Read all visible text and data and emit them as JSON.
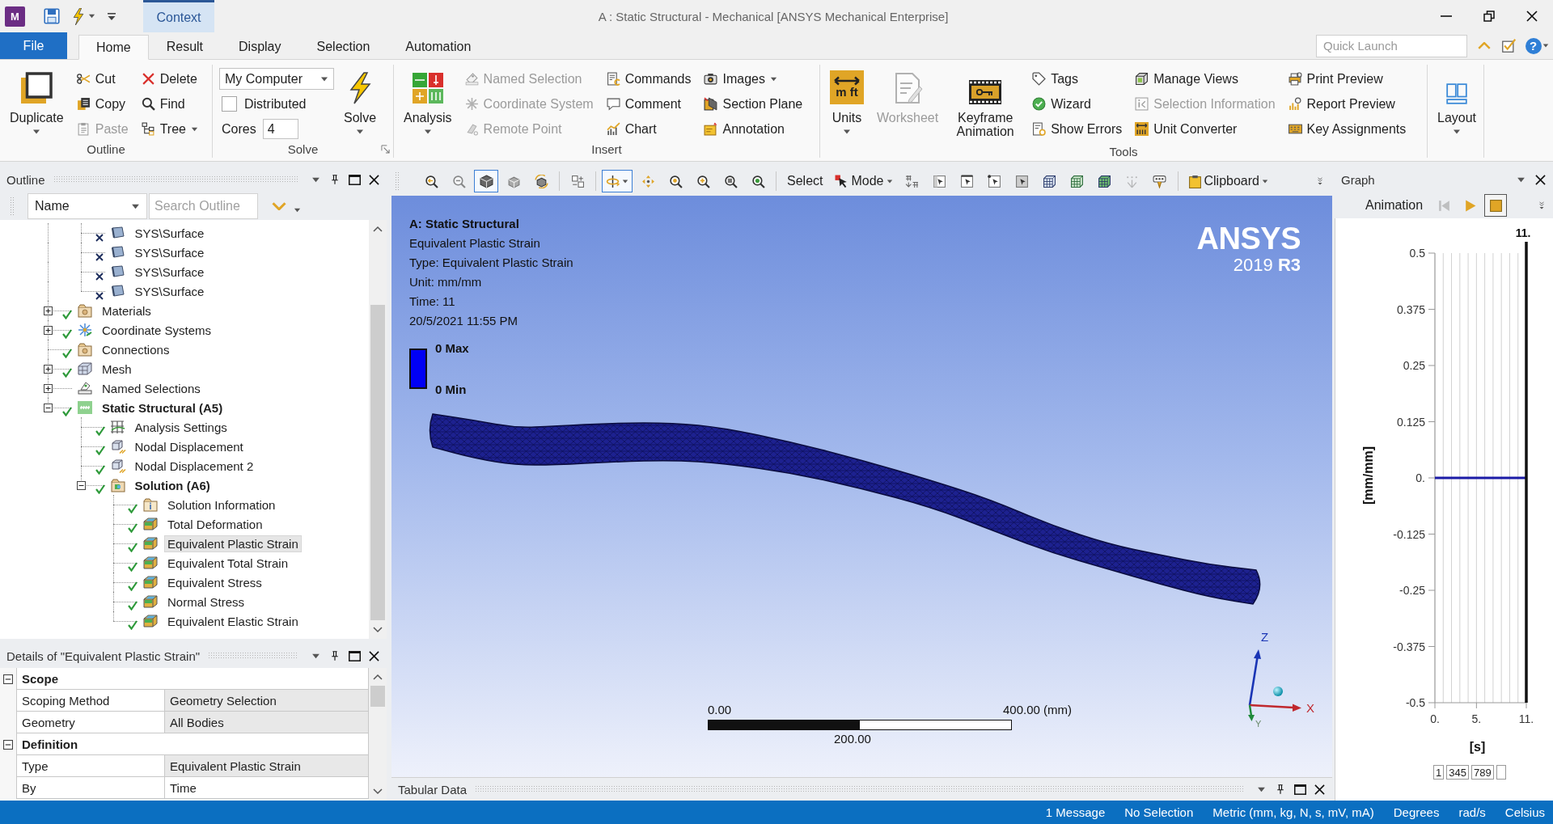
{
  "title_bar": {
    "app_icon": "M",
    "context_tab": "Context",
    "title": "A : Static Structural - Mechanical [ANSYS Mechanical Enterprise]"
  },
  "menu_tabs": [
    {
      "label": "File",
      "kind": "file",
      "selected": false
    },
    {
      "label": "Home",
      "kind": "tab",
      "selected": true
    },
    {
      "label": "Result",
      "kind": "tab",
      "selected": false
    },
    {
      "label": "Display",
      "kind": "tab",
      "selected": false
    },
    {
      "label": "Selection",
      "kind": "tab",
      "selected": false
    },
    {
      "label": "Automation",
      "kind": "tab",
      "selected": false
    }
  ],
  "quick_launch": {
    "placeholder": "Quick Launch",
    "help": "?"
  },
  "ribbon_groups": [
    {
      "label": "Outline",
      "columns": [
        {
          "kind": "large",
          "label": "Duplicate",
          "menu": true,
          "disabled": false
        },
        {
          "kind": "stack",
          "items": [
            {
              "kind": "button",
              "label": "Cut",
              "disabled": false
            },
            {
              "kind": "button",
              "label": "Copy",
              "disabled": false
            },
            {
              "kind": "button",
              "label": "Paste",
              "disabled": true
            }
          ]
        },
        {
          "kind": "stack",
          "items": [
            {
              "kind": "button",
              "label": "Delete",
              "disabled": false
            },
            {
              "kind": "button",
              "label": "Find",
              "disabled": false
            },
            {
              "kind": "button",
              "label": "Tree",
              "menu": true,
              "disabled": false
            }
          ]
        }
      ]
    },
    {
      "label": "Solve",
      "launcher": true,
      "columns": [
        {
          "kind": "stack",
          "items": [
            {
              "kind": "dropdown",
              "value": "My Computer"
            },
            {
              "kind": "checkbox",
              "label": "Distributed",
              "checked": false
            },
            {
              "kind": "spin",
              "label": "Cores",
              "value": "4"
            }
          ]
        },
        {
          "kind": "large",
          "label": "Solve",
          "menu": true,
          "disabled": false
        }
      ]
    },
    {
      "label": "Insert",
      "columns": [
        {
          "kind": "large",
          "label": "Analysis",
          "menu": true,
          "disabled": false
        },
        {
          "kind": "stack",
          "items": [
            {
              "kind": "button",
              "label": "Named Selection",
              "disabled": true
            },
            {
              "kind": "button",
              "label": "Coordinate System",
              "disabled": true
            },
            {
              "kind": "button",
              "label": "Remote Point",
              "disabled": true
            }
          ]
        },
        {
          "kind": "stack",
          "items": [
            {
              "kind": "button",
              "label": "Commands",
              "disabled": false
            },
            {
              "kind": "button",
              "label": "Comment",
              "disabled": false
            },
            {
              "kind": "button",
              "label": "Chart",
              "disabled": false
            }
          ]
        },
        {
          "kind": "stack",
          "items": [
            {
              "kind": "button",
              "label": "Images",
              "menu": true,
              "disabled": false
            },
            {
              "kind": "button",
              "label": "Section Plane",
              "disabled": false
            },
            {
              "kind": "button",
              "label": "Annotation",
              "disabled": false
            }
          ]
        }
      ]
    },
    {
      "label": "Tools",
      "columns": [
        {
          "kind": "large",
          "label": "Units",
          "icon_text": "m ft",
          "menu": true,
          "disabled": false
        },
        {
          "kind": "large",
          "label": "Worksheet",
          "disabled": true
        },
        {
          "kind": "large",
          "label": "Keyframe Animation",
          "disabled": false
        },
        {
          "kind": "stack",
          "items": [
            {
              "kind": "button",
              "label": "Tags",
              "disabled": false
            },
            {
              "kind": "button",
              "label": "Wizard",
              "disabled": false
            },
            {
              "kind": "button",
              "label": "Show Errors",
              "disabled": false
            }
          ]
        },
        {
          "kind": "stack",
          "items": [
            {
              "kind": "button",
              "label": "Manage Views",
              "disabled": false
            },
            {
              "kind": "button",
              "label": "Selection Information",
              "disabled": true
            },
            {
              "kind": "button",
              "label": "Unit Converter",
              "disabled": false
            }
          ]
        },
        {
          "kind": "stack",
          "items": [
            {
              "kind": "button",
              "label": "Print Preview",
              "disabled": false
            },
            {
              "kind": "button",
              "label": "Report Preview",
              "disabled": false
            },
            {
              "kind": "button",
              "label": "Key Assignments",
              "disabled": false
            }
          ]
        }
      ]
    },
    {
      "columns": [
        {
          "kind": "large",
          "label": "Layout",
          "menu": true,
          "disabled": false
        }
      ]
    }
  ],
  "outline": {
    "title": "Outline",
    "filter": "Name",
    "search": {
      "placeholder": "Search Outline"
    },
    "tree": [
      {
        "children": [
          {
            "label": "SYS\\Surface",
            "kind": "body",
            "checked": false,
            "crossed": true,
            "selected": false
          },
          {
            "label": "SYS\\Surface",
            "kind": "body",
            "checked": false,
            "crossed": true,
            "selected": false
          },
          {
            "label": "SYS\\Surface",
            "kind": "body",
            "checked": false,
            "crossed": true,
            "selected": false
          },
          {
            "label": "SYS\\Surface",
            "kind": "body",
            "checked": false,
            "crossed": true,
            "selected": false
          }
        ]
      },
      {
        "label": "Materials",
        "kind": "materials",
        "checked": true,
        "crossed": false,
        "expanded": false,
        "selected": false
      },
      {
        "label": "Coordinate Systems",
        "kind": "coordinates",
        "checked": true,
        "crossed": false,
        "expanded": false,
        "selected": false
      },
      {
        "label": "Connections",
        "kind": "connections",
        "checked": true,
        "crossed": false,
        "selected": false
      },
      {
        "label": "Mesh",
        "kind": "mesh",
        "checked": true,
        "crossed": false,
        "expanded": false,
        "selected": false
      },
      {
        "label": "Named Selections",
        "kind": "named",
        "checked": false,
        "crossed": false,
        "expanded": false,
        "selected": false
      },
      {
        "label": "Static Structural (A5)",
        "kind": "analysis",
        "checked": true,
        "crossed": false,
        "expanded": true,
        "selected": false,
        "children": [
          {
            "label": "Analysis Settings",
            "kind": "settings",
            "checked": true,
            "crossed": false,
            "selected": false
          },
          {
            "label": "Nodal Displacement",
            "kind": "displacement",
            "checked": true,
            "crossed": false,
            "selected": false
          },
          {
            "label": "Nodal Displacement 2",
            "kind": "displacement",
            "checked": true,
            "crossed": false,
            "selected": false
          },
          {
            "label": "Solution (A6)",
            "kind": "solution",
            "checked": true,
            "crossed": false,
            "expanded": true,
            "selected": false,
            "children": [
              {
                "label": "Solution Information",
                "kind": "info",
                "checked": true,
                "crossed": false,
                "selected": false
              },
              {
                "label": "Total Deformation",
                "kind": "result",
                "checked": true,
                "crossed": false,
                "selected": false
              },
              {
                "label": "Equivalent Plastic Strain",
                "kind": "result",
                "checked": true,
                "crossed": false,
                "selected": true
              },
              {
                "label": "Equivalent Total Strain",
                "kind": "result",
                "checked": true,
                "crossed": false,
                "selected": false
              },
              {
                "label": "Equivalent Stress",
                "kind": "result",
                "checked": true,
                "crossed": false,
                "selected": false
              },
              {
                "label": "Normal Stress",
                "kind": "result",
                "checked": true,
                "crossed": false,
                "selected": false
              },
              {
                "label": "Equivalent Elastic Strain",
                "kind": "result",
                "checked": true,
                "crossed": false,
                "selected": false
              }
            ]
          }
        ]
      }
    ]
  },
  "details": {
    "title": "Details of \"Equivalent Plastic Strain\"",
    "groups": [
      {
        "label": "Scope",
        "expanded": true,
        "rows": [
          {
            "name": "Scoping Method",
            "value": "Geometry Selection",
            "readonly": true
          },
          {
            "name": "Geometry",
            "value": "All Bodies",
            "readonly": true
          }
        ]
      },
      {
        "label": "Definition",
        "expanded": true,
        "rows": [
          {
            "name": "Type",
            "value": "Equivalent Plastic Strain",
            "readonly": true
          },
          {
            "name": "By",
            "value": "Time",
            "readonly": false
          }
        ]
      }
    ]
  },
  "viewport_toolbar": {
    "groups": [
      {
        "tools": [
          {
            "kind": "zoomfit",
            "selected": false,
            "disabled": false
          },
          {
            "kind": "zoomout",
            "selected": false,
            "disabled": true
          },
          {
            "kind": "iso",
            "selected": true,
            "disabled": false
          },
          {
            "kind": "shaded",
            "selected": false,
            "disabled": false
          },
          {
            "kind": "rotview",
            "selected": false,
            "disabled": false
          }
        ]
      },
      {
        "tools": [
          {
            "kind": "tiles",
            "selected": false,
            "disabled": false
          }
        ]
      },
      {
        "tools": [
          {
            "kind": "rotate",
            "selected": true,
            "menu": true,
            "disabled": false
          },
          {
            "kind": "pan",
            "selected": false,
            "disabled": false
          },
          {
            "kind": "zoom",
            "selected": false,
            "disabled": false
          },
          {
            "kind": "zoomin",
            "selected": false,
            "disabled": false
          },
          {
            "kind": "boxzoom",
            "selected": false,
            "disabled": false
          },
          {
            "kind": "magnify",
            "selected": false,
            "disabled": false
          }
        ]
      },
      {
        "label": "Select",
        "tools": [
          {
            "kind": "mode",
            "label": "Mode",
            "selected": false,
            "menu": true,
            "disabled": false
          },
          {
            "kind": "extend",
            "selected": false,
            "disabled": false
          },
          {
            "kind": "facesel",
            "selected": false,
            "disabled": false
          },
          {
            "kind": "edgesel",
            "selected": false,
            "disabled": false
          },
          {
            "kind": "vertexsel",
            "selected": false,
            "disabled": false
          },
          {
            "kind": "bodysel",
            "selected": false,
            "disabled": false
          },
          {
            "kind": "nodesel",
            "selected": false,
            "disabled": false
          },
          {
            "kind": "elemfacesel",
            "selected": false,
            "disabled": false
          },
          {
            "kind": "elemsel",
            "selected": false,
            "disabled": false
          },
          {
            "kind": "coordsel",
            "selected": false,
            "disabled": true
          },
          {
            "kind": "probe",
            "selected": false,
            "disabled": false
          }
        ]
      },
      {
        "tools": [
          {
            "kind": "clipboard",
            "label": "Clipboard",
            "selected": false,
            "menu": true,
            "disabled": false
          }
        ]
      }
    ]
  },
  "viewport": {
    "info_title": "A: Static Structural",
    "info_lines": [
      "Equivalent Plastic Strain",
      "Type: Equivalent Plastic Strain",
      "Unit: mm/mm",
      "Time: 11",
      "20/5/2021 11:55 PM"
    ],
    "logo": "ANSYS",
    "version": "2019 **R3**",
    "legend": [
      "0 Max",
      "0 Min"
    ],
    "scale_bar": {
      "start": "0.00",
      "end": "400.00 (mm)",
      "middle": "200.00"
    },
    "triad": {
      "x": "X",
      "y": "Y",
      "z": "Z"
    }
  },
  "tabular_data": {
    "title": "Tabular Data"
  },
  "graph": {
    "title": "Graph",
    "animation_label": "Animation",
    "controls": [
      {
        "kind": "first",
        "disabled": true,
        "selected": false
      },
      {
        "kind": "play",
        "disabled": false,
        "selected": false
      },
      {
        "kind": "stop",
        "disabled": false,
        "selected": true
      }
    ],
    "current_time": "11.",
    "chart_data": {
      "type": "line",
      "xlabel": "[s]",
      "ylabel": "[mm/mm]",
      "x": [
        0,
        11
      ],
      "series": [
        {
          "color": "#1b1ba6",
          "values": [
            0,
            0
          ]
        }
      ],
      "xlim": [
        0,
        11
      ],
      "ylim": [
        -0.5,
        0.5
      ],
      "xticks": [
        {
          "value": 0,
          "label": "0."
        },
        {
          "value": 5,
          "label": "5."
        },
        {
          "value": 11,
          "label": "11."
        }
      ],
      "yticks": [
        0.5,
        0.375,
        0.25,
        0.125,
        {
          "value": 0,
          "label": "0."
        },
        -0.125,
        -0.25,
        -0.375,
        -0.5
      ]
    },
    "steps": [
      "1",
      "345",
      "789"
    ]
  },
  "status_bar": {
    "items": [
      "1 Message",
      "No Selection",
      "Metric (mm, kg, N, s, mV, mA)",
      "Degrees",
      "rad/s",
      "Celsius"
    ]
  }
}
